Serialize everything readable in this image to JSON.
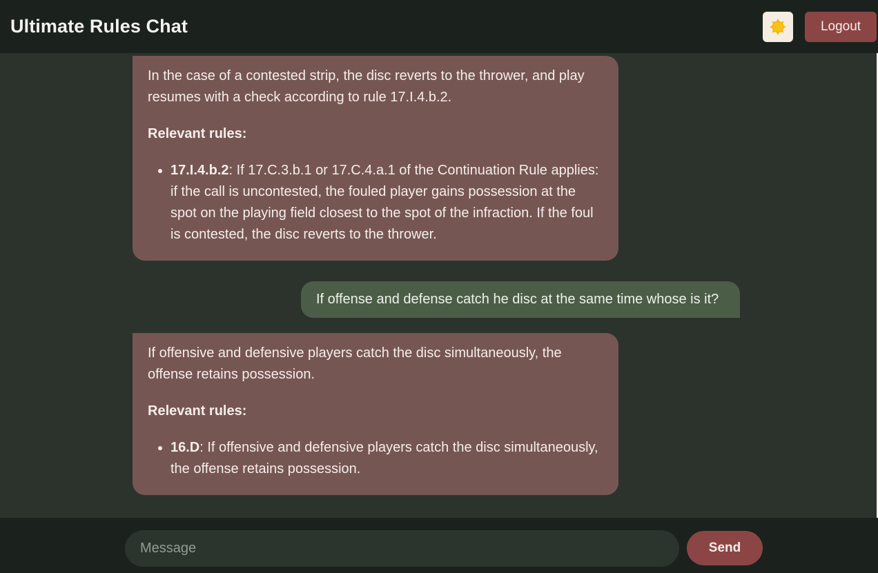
{
  "header": {
    "title": "Ultimate Rules Chat",
    "theme_icon": "sun-icon",
    "logout_label": "Logout"
  },
  "messages": [
    {
      "role": "assistant",
      "answer": "In the case of a contested strip, the disc reverts to the thrower, and play resumes with a check according to rule 17.I.4.b.2.",
      "relevant_label": "Relevant rules:",
      "rules": [
        {
          "id": "17.I.4.b.2",
          "text": ": If 17.C.3.b.1 or 17.C.4.a.1 of the Continuation Rule applies: if the call is uncontested, the fouled player gains possession at the spot on the playing field closest to the spot of the infraction. If the foul is contested, the disc reverts to the thrower."
        }
      ]
    },
    {
      "role": "user",
      "text": "If offense and defense catch he disc at the same time whose is it?"
    },
    {
      "role": "assistant",
      "answer": "If offensive and defensive players catch the disc simultaneously, the offense retains possession.",
      "relevant_label": "Relevant rules:",
      "rules": [
        {
          "id": "16.D",
          "text": ": If offensive and defensive players catch the disc simultaneously, the offense retains possession."
        }
      ]
    }
  ],
  "composer": {
    "placeholder": "Message",
    "value": "",
    "send_label": "Send"
  },
  "colors": {
    "header_bg": "#1b221d",
    "chat_bg": "#2b332c",
    "assistant_bubble": "#765653",
    "user_bubble": "#4b5d47",
    "accent": "#8b4545",
    "sun": "#f5b400"
  }
}
